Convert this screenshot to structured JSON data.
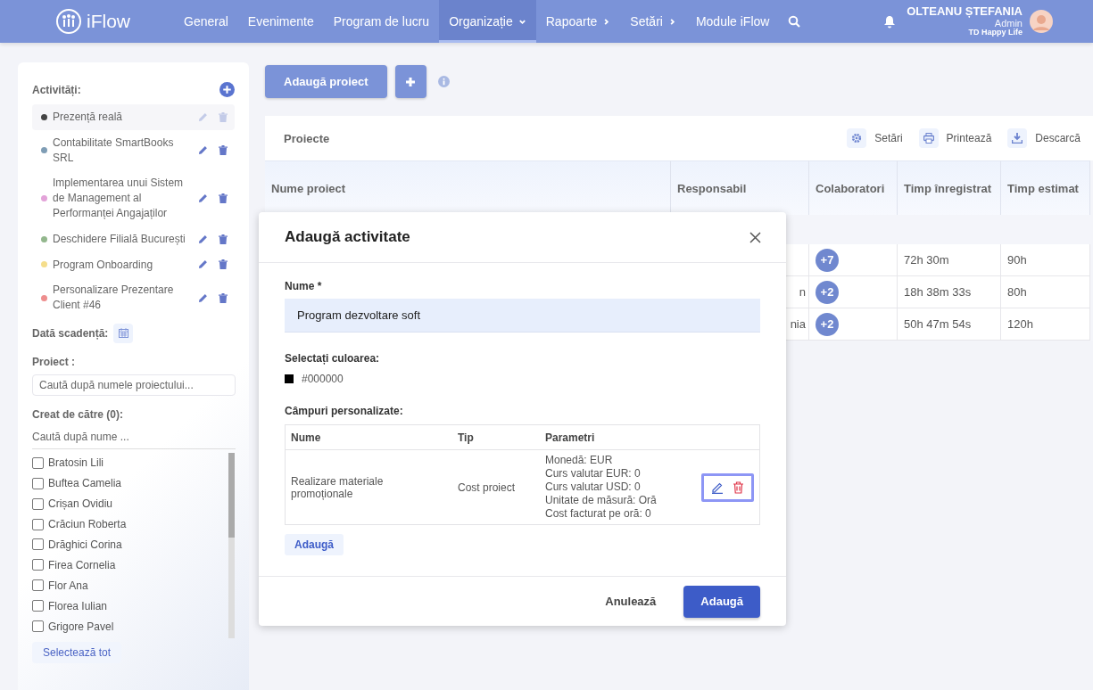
{
  "nav": {
    "logo": "iFlow",
    "items": [
      {
        "label": "General",
        "selected": false,
        "kind": "link"
      },
      {
        "label": "Evenimente",
        "selected": false,
        "kind": "link"
      },
      {
        "label": "Program de lucru",
        "selected": false,
        "kind": "link"
      },
      {
        "label": "Organizație",
        "selected": true,
        "kind": "dropdown"
      },
      {
        "label": "Rapoarte",
        "selected": false,
        "kind": "submenu"
      },
      {
        "label": "Setări",
        "selected": false,
        "kind": "submenu"
      },
      {
        "label": "Module iFlow",
        "selected": false,
        "kind": "link"
      }
    ],
    "user": {
      "name": "OLTEANU ȘTEFANIA",
      "role": "Admin",
      "company": "TD Happy Life"
    }
  },
  "sidebar": {
    "activities_label": "Activități:",
    "activities": [
      {
        "label": "Prezență reală",
        "color": "#444444",
        "selected": true
      },
      {
        "label": "Contabilitate SmartBooks SRL",
        "color": "#7f9db5",
        "selected": false
      },
      {
        "label": "Implementarea unui Sistem de Management al Performanței Angajaților",
        "color": "#e3a3d9",
        "selected": false
      },
      {
        "label": "Deschidere Filială București",
        "color": "#93b78d",
        "selected": false
      },
      {
        "label": "Program Onboarding",
        "color": "#f5de8c",
        "selected": false
      },
      {
        "label": "Personalizare Prezentare Client #46",
        "color": "#ee8e8e",
        "selected": false
      }
    ],
    "due_date_label": "Dată scadență:",
    "project_label": "Proiect :",
    "project_placeholder": "Caută după numele proiectului...",
    "creator_label": "Creat de către (0):",
    "creator_placeholder": "Caută după nume ...",
    "people": [
      {
        "name": "Bratosin Lili",
        "checked": false
      },
      {
        "name": "Buftea Camelia",
        "checked": false
      },
      {
        "name": "Crișan Ovidiu",
        "checked": false
      },
      {
        "name": "Crăciun Roberta",
        "checked": false
      },
      {
        "name": "Drăghici Corina",
        "checked": false
      },
      {
        "name": "Firea Cornelia",
        "checked": false
      },
      {
        "name": "Flor Ana",
        "checked": false
      },
      {
        "name": "Florea Iulian",
        "checked": false
      },
      {
        "name": "Grigore Pavel",
        "checked": false
      }
    ],
    "select_all": "Selectează tot"
  },
  "toolbar": {
    "add_project": "Adaugă proiect"
  },
  "projects": {
    "title": "Proiecte",
    "actions": [
      {
        "label": "Setări",
        "kind": "gear"
      },
      {
        "label": "Printează",
        "kind": "printer"
      },
      {
        "label": "Descarcă",
        "kind": "download"
      }
    ],
    "columns": [
      "Nume proiect",
      "Responsabil",
      "Colaboratori",
      "Timp înregistrat",
      "Timp estimat"
    ],
    "rows": [
      {
        "responsible": "",
        "collaborators": "+7",
        "logged": "72h 30m",
        "estimated": "90h"
      },
      {
        "responsible": "n",
        "collaborators": "+2",
        "logged": "18h 38m 33s",
        "estimated": "80h"
      },
      {
        "responsible": "nia",
        "collaborators": "+2",
        "logged": "50h 47m 54s",
        "estimated": "120h"
      }
    ]
  },
  "dialog": {
    "title": "Adaugă activitate",
    "name_label": "Nume *",
    "name_value": "Program dezvoltare soft",
    "color_label": "Selectați culoarea:",
    "color": "#000000",
    "color_text": "#000000",
    "fields_label": "Câmpuri personalizate:",
    "fields_columns": [
      "Nume",
      "Tip",
      "Parametri"
    ],
    "fields": [
      {
        "name": "Realizare materiale promoționale",
        "type": "Cost proiect",
        "params": [
          "Monedă: EUR",
          "Curs valutar EUR: 0",
          "Curs valutar USD: 0",
          "Unitate de măsură: Oră",
          "Cost facturat pe oră: 0"
        ]
      }
    ],
    "add_field": "Adaugă",
    "cancel": "Anulează",
    "submit": "Adaugă"
  }
}
